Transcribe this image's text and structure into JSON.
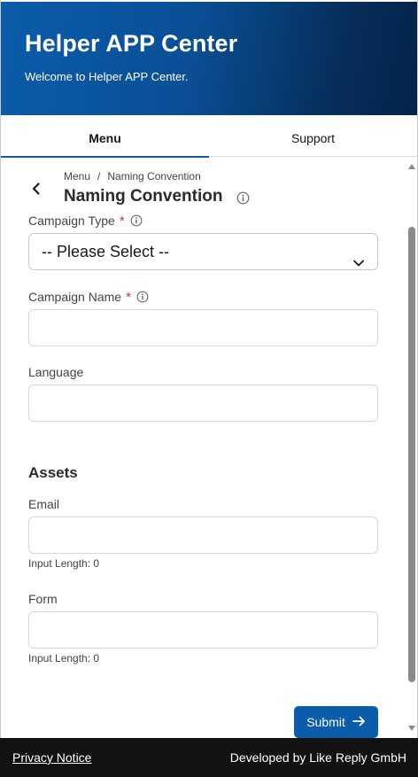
{
  "header": {
    "title": "Helper APP Center",
    "subtitle": "Welcome to Helper APP Center."
  },
  "tabs": [
    {
      "label": "Menu",
      "active": true
    },
    {
      "label": "Support",
      "active": false
    }
  ],
  "breadcrumb": {
    "root": "Menu",
    "separator": "/",
    "current": "Naming Convention"
  },
  "page": {
    "title": "Naming Convention"
  },
  "form": {
    "campaign_type": {
      "label": "Campaign Type",
      "required_mark": "*",
      "selected": "-- Please Select --"
    },
    "campaign_name": {
      "label": "Campaign Name",
      "required_mark": "*",
      "value": ""
    },
    "language": {
      "label": "Language",
      "value": ""
    },
    "assets_title": "Assets",
    "email": {
      "label": "Email",
      "value": "",
      "hint": "Input Length: 0"
    },
    "form_field": {
      "label": "Form",
      "value": "",
      "hint": "Input Length: 0"
    },
    "submit_label": "Submit"
  },
  "footer": {
    "privacy": "Privacy Notice",
    "developer": "Developed by Like Reply GmbH"
  },
  "colors": {
    "brand": "#0b5cab",
    "required": "#c23934",
    "footer_bg": "#121212"
  }
}
